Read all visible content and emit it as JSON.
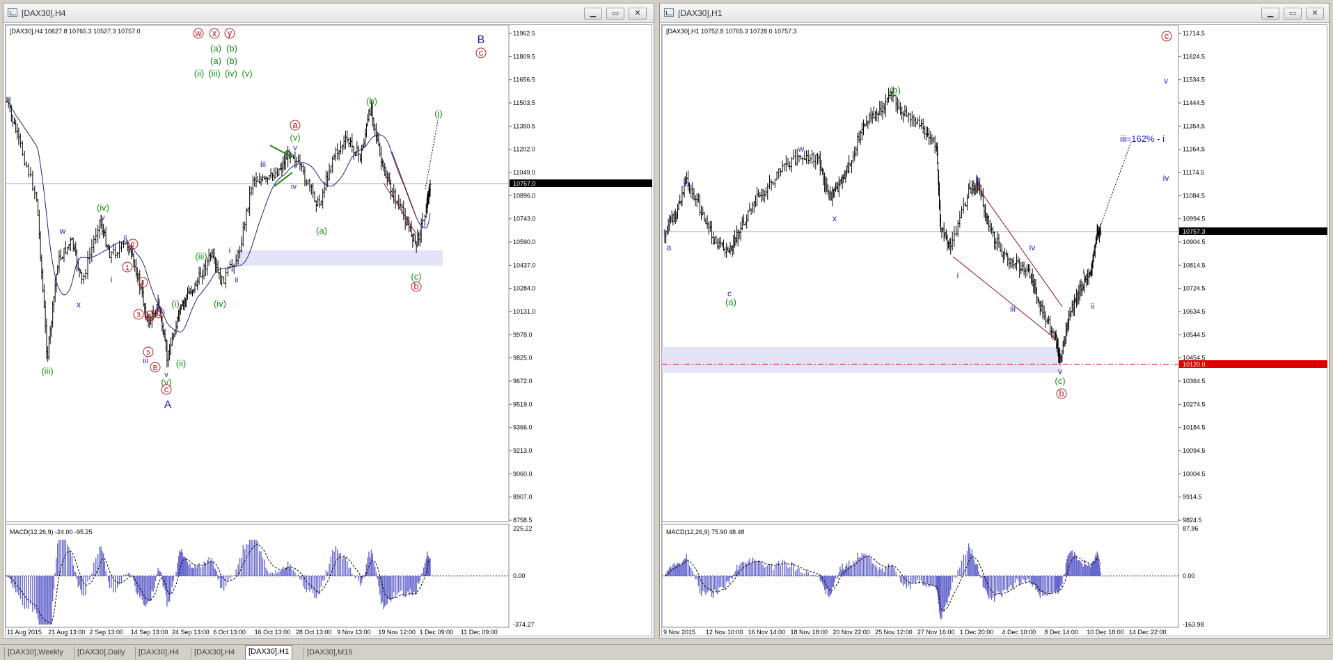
{
  "windows": [
    {
      "id": "w1",
      "title": "[DAX30],H4",
      "info": "[DAX30],H4  10627.8 10765.3 10527.3 10757.0",
      "price_labels": [
        "11962.5",
        "11809.5",
        "11656.5",
        "11503.5",
        "11350.5",
        "11202.0",
        "11049.0",
        "10896.0",
        "10743.0",
        "10590.0",
        "10437.0",
        "10284.0",
        "10131.0",
        "9978.0",
        "9825.0",
        "9672.0",
        "9519.0",
        "9366.0",
        "9213.0",
        "9060.0",
        "8907.0",
        "8758.5"
      ],
      "current_price": "10757.0",
      "macd_label": "MACD(12,26,9) -24.00 -95.25",
      "macd_scale": [
        "225.22",
        "0.00",
        "-374.27"
      ],
      "time_labels": [
        "11 Aug 2015",
        "21 Aug 13:00",
        "2 Sep 13:00",
        "14 Sep 13:00",
        "24 Sep 13:00",
        "6 Oct 13:00",
        "16 Oct 13:00",
        "28 Oct 13:00",
        "9 Nov 13:00",
        "19 Nov 12:00",
        "1 Dec 09:00",
        "11 Dec 09:00"
      ],
      "annotations": {
        "top_red": [
          "w",
          "x",
          "y"
        ],
        "row_ab1": [
          "(a)",
          "(b)"
        ],
        "row_ab2": [
          "(a)",
          "(b)"
        ],
        "row_waves": [
          "(ii)",
          "(iii)",
          "(iv)",
          "(v)"
        ],
        "B": "B",
        "c_top": "c",
        "a_red": "a",
        "v_green": "(v)",
        "v_blue": "v",
        "iii_blue": "iii",
        "iv_blue": "iv",
        "b_green": "(b)",
        "i_box": "(i)",
        "a_green": "(a)",
        "c_green": "(c)",
        "b_red": "b",
        "i_blue": "i",
        "ii_blue": "ii",
        "iii_green_mid": "(iii)",
        "iv_green_mid": "(iv)",
        "i_green": "(i)",
        "ii_green": "(ii)",
        "v_blue_low": "v",
        "v_green_low": "(v)",
        "c_red_low": "c",
        "A": "A",
        "iv_green_left": "(iv)",
        "v_blue_left": "v",
        "w_blue": "w",
        "x_blue": "x",
        "i_blue_left": "i",
        "ii_blue_left": "ii",
        "iii_green_left": "(iii)",
        "n1": "1",
        "n2": "2",
        "n3": "3",
        "n4": "4",
        "n5": "5",
        "A_red": "A",
        "B_red": "B",
        "C_red": "C",
        "iii_blue_low": "iii",
        "iv_blue_low": "iv"
      }
    },
    {
      "id": "w2",
      "title": "[DAX30],H1",
      "info": "[DAX30],H1  10752.8 10765.3 10728.0 10757.3",
      "price_labels": [
        "11714.5",
        "11624.5",
        "11534.5",
        "11444.5",
        "11354.5",
        "11264.5",
        "11174.5",
        "11084.5",
        "10994.5",
        "10904.5",
        "10814.5",
        "10724.5",
        "10634.5",
        "10544.5",
        "10454.5",
        "10364.5",
        "10274.5",
        "10184.5",
        "10094.5",
        "10004.5",
        "9914.5",
        "9824.5"
      ],
      "current_price": "10757.3",
      "level_price": "10120.0",
      "macd_label": "MACD(12,26,9) 75.90 48.48",
      "macd_scale": [
        "87.86",
        "0.00",
        "-163.98"
      ],
      "time_labels": [
        "9 Nov 2015",
        "12 Nov 10:00",
        "16 Nov 14:00",
        "18 Nov 18:00",
        "20 Nov 22:00",
        "25 Nov 12:00",
        "27 Nov 16:00",
        "1 Dec 20:00",
        "4 Dec 10:00",
        "8 Dec 14:00",
        "10 Dec 18:00",
        "14 Dec 22:00"
      ],
      "annotations": {
        "c_red_top": "c",
        "v_blue": "v",
        "iii_target": "iii=162% - i",
        "iv_blue_r": "iv",
        "b_green": "(b)",
        "w_blue": "w",
        "x_blue": "x",
        "b_blue": "b",
        "a_blue": "a",
        "c_blue": "c",
        "a_green": "(a)",
        "ii_blue": "ii",
        "i_blue": "i",
        "iv_blue": "iv",
        "iii_blue": "iii",
        "v_blue_low": "v",
        "c_green": "(c)",
        "b_red": "b",
        "i_blue_r": "i",
        "ii_blue_r": "ii"
      }
    }
  ],
  "tabs": [
    "[DAX30],Weekly",
    "[DAX30],Daily",
    "[DAX30],H4",
    "[DAX30],H4",
    "[DAX30],H1",
    "[DAX30],M15"
  ],
  "active_tab": 4,
  "colors": {
    "red": "#c0161b",
    "green": "#138a13",
    "blue": "#1d1dbf",
    "ma": "#1f1f8f",
    "zone": "#e4e4f7",
    "hist": "#6666cc"
  }
}
